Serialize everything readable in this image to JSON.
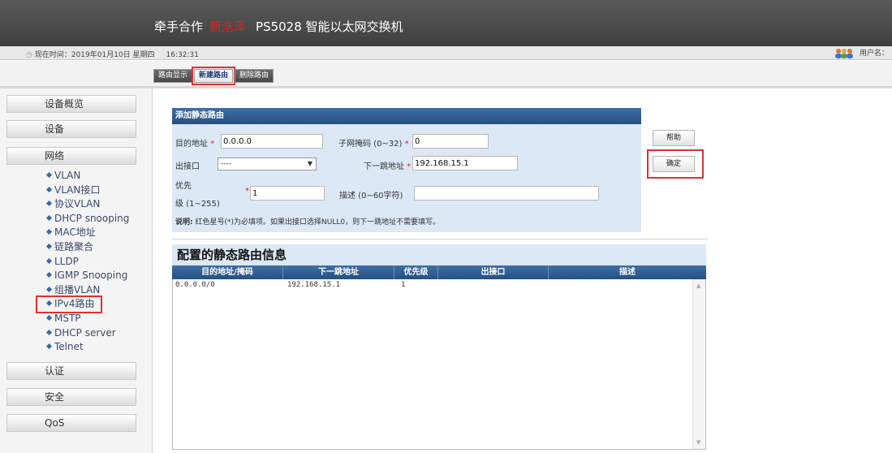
{
  "header": {
    "brand_prefix": "牵手合作",
    "brand_highlight": "新浩泽",
    "model_title": "PS5028 智能以太网交换机"
  },
  "statusbar": {
    "time_label": "现在时间：2019年01月10日  星期四",
    "time_value": "16:32:31",
    "user_label": "用户名："
  },
  "tabs": [
    {
      "label": "路由显示",
      "active": false
    },
    {
      "label": "新建路由",
      "active": true
    },
    {
      "label": "删除路由",
      "active": false
    }
  ],
  "sidebar": {
    "menu": [
      "设备概览",
      "设备",
      "网络",
      "认证",
      "安全",
      "QoS"
    ],
    "network_items": [
      "VLAN",
      "VLAN接口",
      "协议VLAN",
      "DHCP snooping",
      "MAC地址",
      "链路聚合",
      "LLDP",
      "IGMP Snooping",
      "组播VLAN",
      "IPv4路由",
      "MSTP",
      "DHCP server",
      "Telnet"
    ],
    "active_item": "IPv4路由"
  },
  "form": {
    "title": "添加静态路由",
    "dest_label": "目的地址",
    "dest_value": "0.0.0.0",
    "mask_label": "子网掩码 (0~32)",
    "mask_value": "0",
    "iface_label": "出接口",
    "iface_value": "----",
    "nexthop_label": "下一跳地址",
    "nexthop_value": "192.168.15.1",
    "priority_label_1": "优先",
    "priority_label_2": "级 (1~255)",
    "priority_value": "1",
    "desc_label": "描述 (0~60字符)",
    "desc_value": "",
    "note_bold": "说明:",
    "note_text": "红色星号(*)为必填项。如果出接口选择NULL0，则下一跳地址不需要填写。",
    "help_label": "帮助",
    "confirm_label": "确定",
    "required_mark": "*"
  },
  "table": {
    "title": "配置的静态路由信息",
    "columns": [
      "目的地址/掩码",
      "下一跳地址",
      "优先级",
      "出接口",
      "描述"
    ],
    "rows": [
      [
        "0.0.0.0/0",
        "192.168.15.1",
        "1",
        "",
        ""
      ]
    ]
  },
  "colors": {
    "accent_blue": "#26507f",
    "panel_bg": "#dce8f5",
    "highlight_red": "#e03030"
  }
}
